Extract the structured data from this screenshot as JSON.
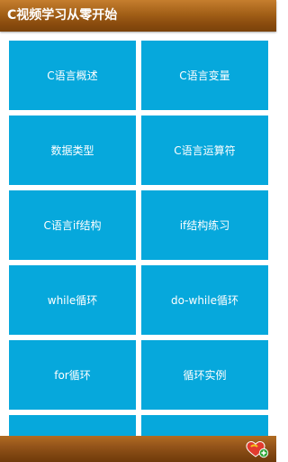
{
  "header": {
    "title": "C视频学习从零开始"
  },
  "grid": {
    "tiles": [
      {
        "label": "C语言概述"
      },
      {
        "label": "C语言变量"
      },
      {
        "label": "数据类型"
      },
      {
        "label": "C语言运算符"
      },
      {
        "label": "C语言if结构"
      },
      {
        "label": "if结构练习"
      },
      {
        "label": "while循环"
      },
      {
        "label": "do-while循环"
      },
      {
        "label": "for循环"
      },
      {
        "label": "循环实例"
      }
    ]
  },
  "bottom_bar": {
    "icon": "heart-plus-icon"
  },
  "colors": {
    "header": "#a25f17",
    "tile": "#06a8dc",
    "bottom_bar": "#7d4410"
  }
}
